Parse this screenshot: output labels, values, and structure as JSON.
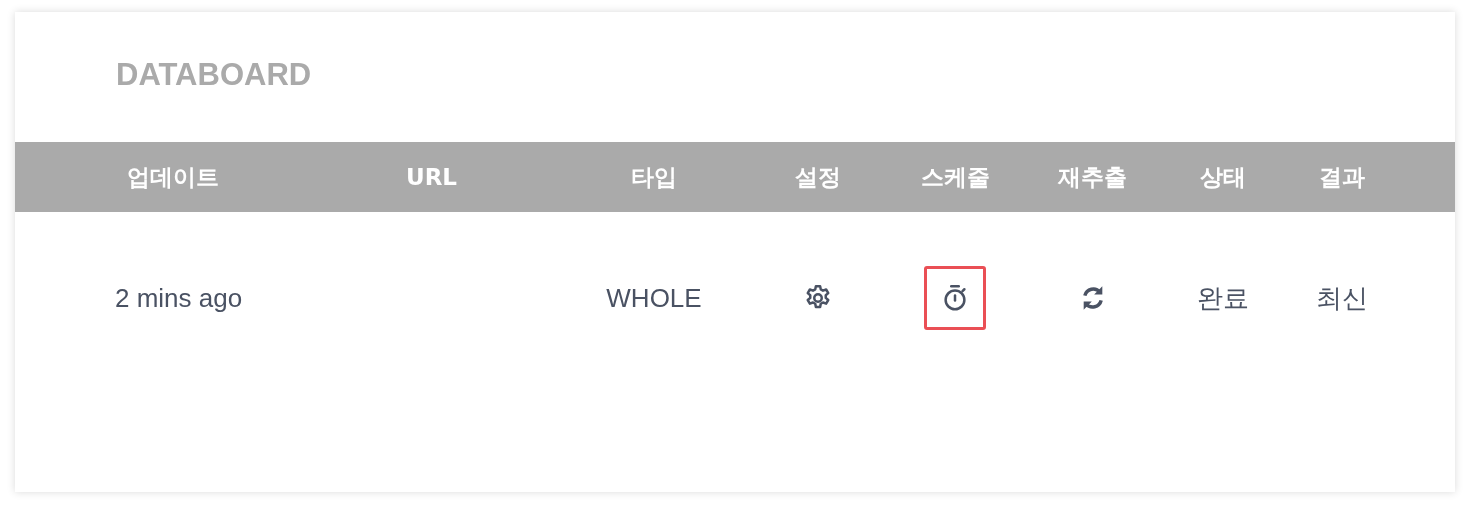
{
  "title": "DATABOARD",
  "table": {
    "columns": [
      "업데이트",
      "URL",
      "타입",
      "설정",
      "스케줄",
      "재추출",
      "상태",
      "결과"
    ],
    "rows": [
      {
        "updated": "2 mins ago",
        "type": "WHOLE",
        "status": "완료",
        "result": "최신",
        "schedule_highlighted": true
      }
    ]
  }
}
